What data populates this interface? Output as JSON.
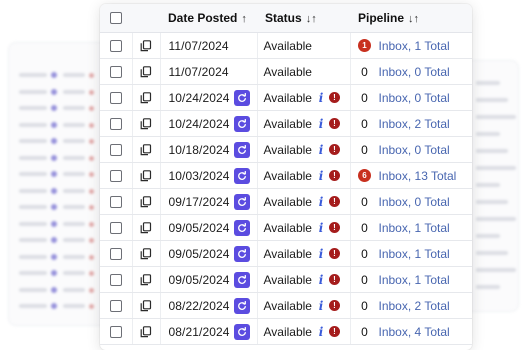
{
  "header": {
    "date_posted": "Date Posted",
    "date_sort_icon": "↑",
    "status": "Status",
    "status_sort_icon": "↓↑",
    "pipeline": "Pipeline",
    "pipeline_sort_icon": "↓↑"
  },
  "icons": {
    "copy": "copy-icon",
    "repost": "refresh-icon",
    "info": "i",
    "alert": "!"
  },
  "colors": {
    "repost_button": "#5b4ce0",
    "alert": "#a51c1c",
    "pipeline_badge": "#c8301f",
    "link": "#4866b0",
    "info": "#3a5bd9"
  },
  "rows": [
    {
      "date": "11/07/2024",
      "repost": false,
      "status": "Available",
      "status_icons": false,
      "pipeline_count": "1",
      "pipeline_badge": true,
      "pipeline_text": "Inbox, 1 Total"
    },
    {
      "date": "11/07/2024",
      "repost": false,
      "status": "Available",
      "status_icons": false,
      "pipeline_count": "0",
      "pipeline_badge": false,
      "pipeline_text": "Inbox, 0 Total"
    },
    {
      "date": "10/24/2024",
      "repost": true,
      "status": "Available",
      "status_icons": true,
      "pipeline_count": "0",
      "pipeline_badge": false,
      "pipeline_text": "Inbox, 0 Total"
    },
    {
      "date": "10/24/2024",
      "repost": true,
      "status": "Available",
      "status_icons": true,
      "pipeline_count": "0",
      "pipeline_badge": false,
      "pipeline_text": "Inbox, 2 Total"
    },
    {
      "date": "10/18/2024",
      "repost": true,
      "status": "Available",
      "status_icons": true,
      "pipeline_count": "0",
      "pipeline_badge": false,
      "pipeline_text": "Inbox, 0 Total"
    },
    {
      "date": "10/03/2024",
      "repost": true,
      "status": "Available",
      "status_icons": true,
      "pipeline_count": "6",
      "pipeline_badge": true,
      "pipeline_text": "Inbox, 13 Total"
    },
    {
      "date": "09/17/2024",
      "repost": true,
      "status": "Available",
      "status_icons": true,
      "pipeline_count": "0",
      "pipeline_badge": false,
      "pipeline_text": "Inbox, 0 Total"
    },
    {
      "date": "09/05/2024",
      "repost": true,
      "status": "Available",
      "status_icons": true,
      "pipeline_count": "0",
      "pipeline_badge": false,
      "pipeline_text": "Inbox, 1 Total"
    },
    {
      "date": "09/05/2024",
      "repost": true,
      "status": "Available",
      "status_icons": true,
      "pipeline_count": "0",
      "pipeline_badge": false,
      "pipeline_text": "Inbox, 1 Total"
    },
    {
      "date": "09/05/2024",
      "repost": true,
      "status": "Available",
      "status_icons": true,
      "pipeline_count": "0",
      "pipeline_badge": false,
      "pipeline_text": "Inbox, 1 Total"
    },
    {
      "date": "08/22/2024",
      "repost": true,
      "status": "Available",
      "status_icons": true,
      "pipeline_count": "0",
      "pipeline_badge": false,
      "pipeline_text": "Inbox, 2 Total"
    },
    {
      "date": "08/21/2024",
      "repost": true,
      "status": "Available",
      "status_icons": true,
      "pipeline_count": "0",
      "pipeline_badge": false,
      "pipeline_text": "Inbox, 4 Total"
    }
  ]
}
